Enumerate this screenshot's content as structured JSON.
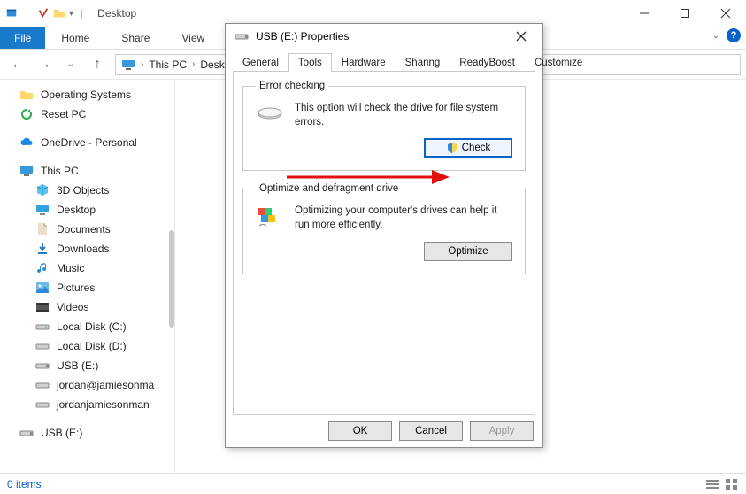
{
  "window": {
    "title": "Desktop",
    "min_tooltip": "Minimize",
    "max_tooltip": "Maximize",
    "close_tooltip": "Close"
  },
  "menus": {
    "file": "File",
    "home": "Home",
    "share": "Share",
    "view": "View"
  },
  "nav": {
    "crumb1": "This PC",
    "crumb2": "Desktop"
  },
  "sidebar": {
    "operating_systems": "Operating Systems",
    "reset_pc": "Reset PC",
    "onedrive": "OneDrive - Personal",
    "this_pc": "This PC",
    "children": {
      "objects3d": "3D Objects",
      "desktop": "Desktop",
      "documents": "Documents",
      "downloads": "Downloads",
      "music": "Music",
      "pictures": "Pictures",
      "videos": "Videos",
      "localc": "Local Disk (C:)",
      "locald": "Local Disk (D:)",
      "usbe": "USB (E:)",
      "jordan1": "jordan@jamiesonma",
      "jordan2": "jordanjamiesonman"
    },
    "usb_drive": "USB (E:)"
  },
  "status": {
    "items": "0 items"
  },
  "dialog": {
    "title": "USB (E:) Properties",
    "tabs": {
      "general": "General",
      "tools": "Tools",
      "hardware": "Hardware",
      "sharing": "Sharing",
      "readyboost": "ReadyBoost",
      "customize": "Customize"
    },
    "error_checking": {
      "legend": "Error checking",
      "text": "This option will check the drive for file system errors.",
      "button": "Check"
    },
    "optimize": {
      "legend": "Optimize and defragment drive",
      "text": "Optimizing your computer's drives can help it run more efficiently.",
      "button": "Optimize"
    },
    "footer": {
      "ok": "OK",
      "cancel": "Cancel",
      "apply": "Apply"
    }
  }
}
